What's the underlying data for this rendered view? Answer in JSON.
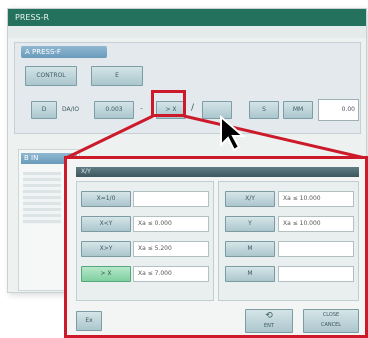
{
  "window": {
    "title": "PRESS-R",
    "sub_icon": ""
  },
  "panel": {
    "header": "A PRESS-F",
    "row1": {
      "btn1": "CONTROL",
      "btn2": "E"
    },
    "row2": {
      "btn_left": "D",
      "label": "DA/IO",
      "btn_value": "0.003",
      "btn_hl": "> X",
      "btn_empty": "",
      "btn_s": "S",
      "btn_mm": "MM",
      "field_value": "0.00"
    }
  },
  "panel2": {
    "header": "B IN"
  },
  "popup": {
    "title": "X/Y",
    "left": [
      {
        "btn": "X=1/0",
        "text": ""
      },
      {
        "btn": "X<Y",
        "text": "Xa   ≤ 0.000"
      },
      {
        "btn": "X>Y",
        "text": "Xa   ≤ 5.200"
      },
      {
        "btn": "> X",
        "text": "Xa   ≤ 7.000",
        "selected": true
      }
    ],
    "right": [
      {
        "btn": "X/Y",
        "text": "Xa   ≤ 10.000"
      },
      {
        "btn": "Y",
        "text": "Xa   ≤ 10.000"
      },
      {
        "btn": "M",
        "text": ""
      },
      {
        "btn": "M",
        "text": ""
      }
    ],
    "footer": {
      "left": "Ex",
      "ok": "OK",
      "ok_sub": "ENT",
      "cancel": "CLOSE",
      "cancel_sub": "CANCEL"
    }
  },
  "colors": {
    "accent_red": "#cc1a2b",
    "title_green": "#24715d",
    "selected_green": "#7fcf9f"
  }
}
